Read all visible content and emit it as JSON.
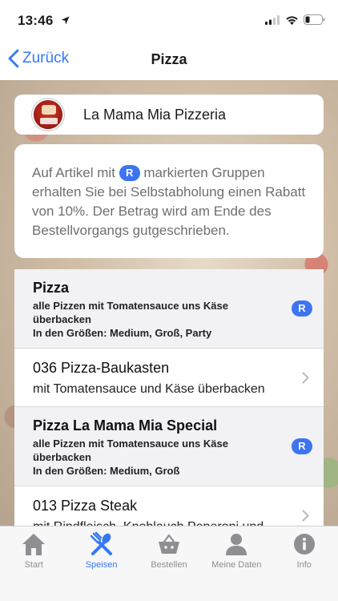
{
  "status": {
    "time": "13:46"
  },
  "nav": {
    "back_label": "Zurück",
    "title": "Pizza"
  },
  "restaurant": {
    "name": "La Mama Mia Pizzeria"
  },
  "info": {
    "text_before": "Auf Artikel mit ",
    "badge": "R",
    "text_after": " markierten Gruppen erhalten Sie bei Selbstabholung einen Rabatt von 10%. Der Betrag wird am Ende des Bestellvorgangs gutgeschrieben."
  },
  "rows": [
    {
      "type": "group",
      "title": "Pizza",
      "subtitle": "alle Pizzen mit Tomatensauce uns Käse überbacken",
      "sizes": "In den Größen: Medium, Groß, Party",
      "badge": "R"
    },
    {
      "type": "item",
      "title": "036 Pizza-Baukasten",
      "desc": "mit Tomatensauce und Käse überbacken"
    },
    {
      "type": "group",
      "title": "Pizza La Mama Mia Special",
      "subtitle": "alle Pizzen mit Tomatensauce uns Käse überbacken",
      "sizes": "In den Größen: Medium, Groß",
      "badge": "R"
    },
    {
      "type": "item",
      "title": "013 Pizza Steak",
      "desc": "mit Rindfleisch, Knoblauch,Peperoni und"
    }
  ],
  "tabs": [
    {
      "label": "Start",
      "icon": "home-icon",
      "active": false
    },
    {
      "label": "Speisen",
      "icon": "cutlery-icon",
      "active": true
    },
    {
      "label": "Bestellen",
      "icon": "basket-icon",
      "active": false
    },
    {
      "label": "Meine Daten",
      "icon": "person-icon",
      "active": false
    },
    {
      "label": "Info",
      "icon": "info-icon",
      "active": false
    }
  ],
  "colors": {
    "accent": "#3478f6",
    "badge": "#3c74f2",
    "inactive": "#8e8e93"
  }
}
